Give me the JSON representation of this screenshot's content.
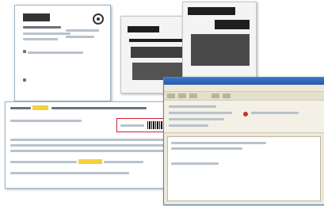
{
  "form_document": {
    "title": "",
    "fields": [
      "",
      "",
      "",
      "",
      "",
      ""
    ]
  },
  "scan_document": {
    "title": ""
  },
  "highlight_document": {
    "heading": "",
    "highlighted_term": "",
    "barcode_label": "",
    "paragraphs": [
      "",
      "",
      "",
      ""
    ]
  },
  "email_client": {
    "window_title": "",
    "menu_items": [
      "",
      "",
      "",
      "",
      "",
      ""
    ],
    "headers": [
      "",
      "",
      "",
      ""
    ],
    "body_lines": [
      "",
      "",
      ""
    ]
  },
  "colors": {
    "highlight": "#f3d23a",
    "barcode_box": "#d81f2a",
    "mail_titlebar": "#2a5aa8"
  }
}
